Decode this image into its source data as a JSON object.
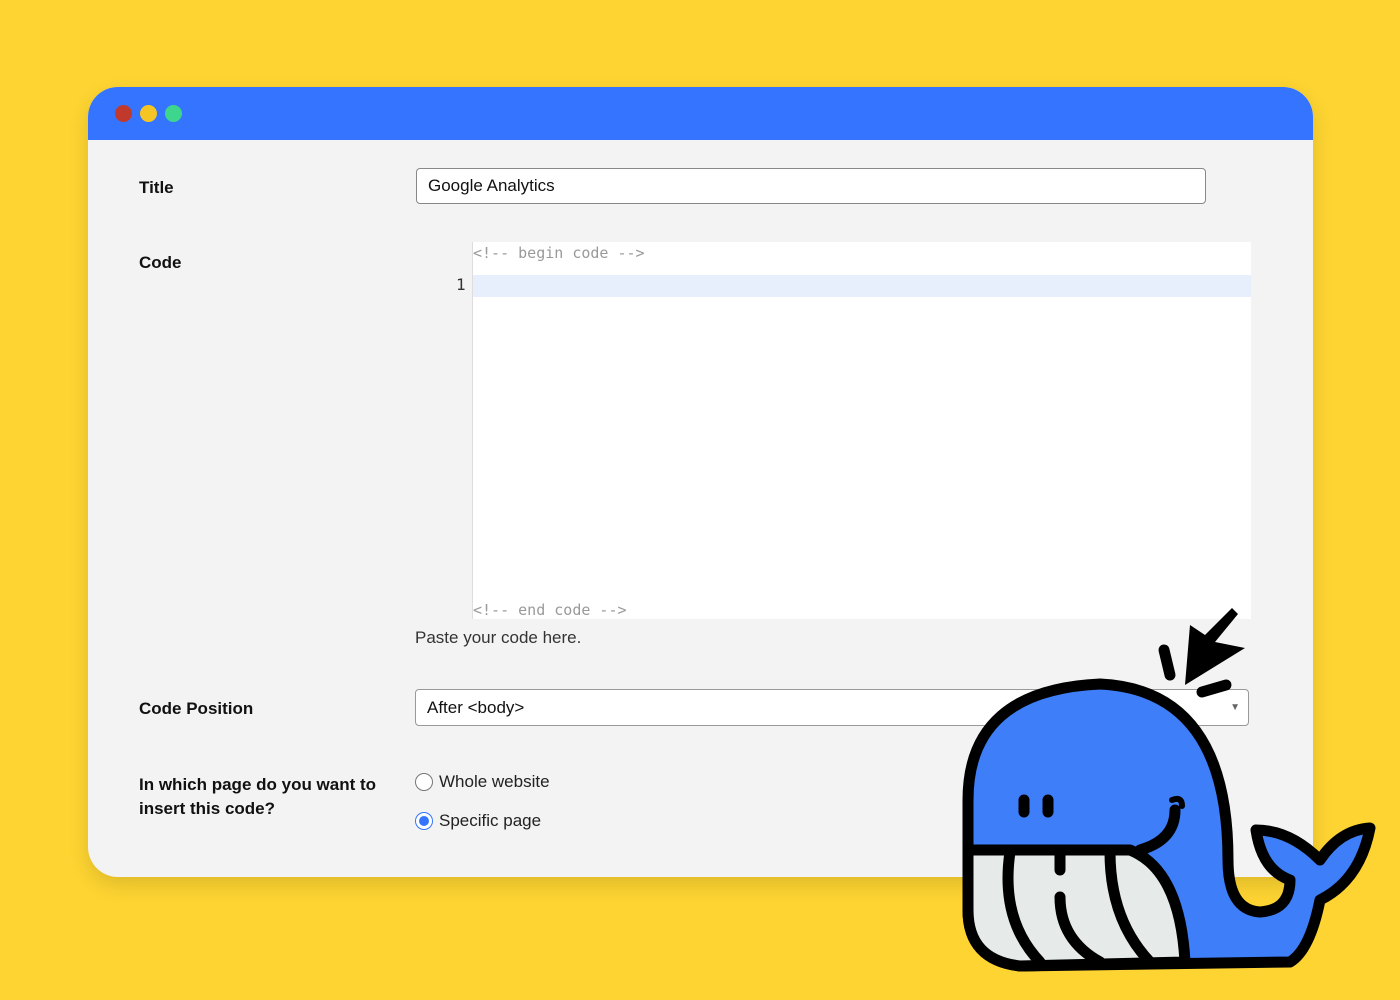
{
  "window": {
    "dots": [
      "#C0392B",
      "#F5C623",
      "#3DD68C"
    ],
    "titlebar_color": "#3474FF"
  },
  "form": {
    "title_label": "Title",
    "title_value": "Google Analytics",
    "code_label": "Code",
    "code_begin": "<!-- begin code -->",
    "code_end": "<!-- end code -->",
    "line_number": "1",
    "code_help": "Paste your code here.",
    "position_label": "Code Position",
    "position_value": "After <body>",
    "page_label_1": "In which page do you want to",
    "page_label_2": "insert this code?",
    "options": [
      {
        "label": "Whole website",
        "selected": false
      },
      {
        "label": "Specific page",
        "selected": true
      }
    ]
  }
}
